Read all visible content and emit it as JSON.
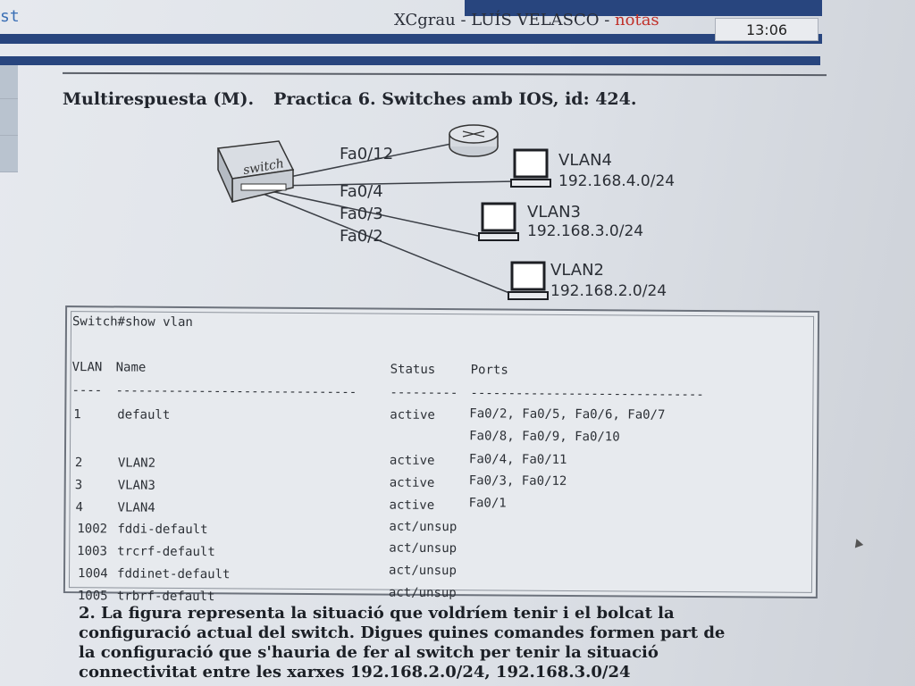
{
  "header": {
    "left_fragment": "st",
    "title_main": "XCgrau - LUÍS VELASCO - ",
    "title_suffix": "notas",
    "clock": "13:06"
  },
  "question": {
    "title_part1": "Multirespuesta (M).",
    "title_part2": "Practica 6. Switches amb IOS, id: 424.",
    "body_lines": [
      "2. La figura representa la situació que voldríem tenir i el bolcat la",
      "configuració actual del switch. Digues quines comandes formen part de",
      "la configuració que s'hauria de fer al switch per tenir la situació",
      "connectivitat entre les xarxes 192.168.2.0/24, 192.168.3.0/24"
    ]
  },
  "diagram": {
    "switch_label": "switch",
    "links": [
      {
        "port": "Fa0/12",
        "target": "router"
      },
      {
        "port": "Fa0/4",
        "target": "VLAN4"
      },
      {
        "port": "Fa0/3",
        "target": "VLAN3"
      },
      {
        "port": "Fa0/2",
        "target": "VLAN2"
      }
    ],
    "hosts": [
      {
        "vlan": "VLAN4",
        "network": "192.168.4.0/24"
      },
      {
        "vlan": "VLAN3",
        "network": "192.168.3.0/24"
      },
      {
        "vlan": "VLAN2",
        "network": "192.168.2.0/24"
      }
    ]
  },
  "terminal": {
    "command": "Switch#show vlan",
    "headers": {
      "vlan": "VLAN",
      "name": "Name",
      "status": "Status",
      "ports": "Ports"
    },
    "separator": {
      "vlan": "----",
      "name": "--------------------------------",
      "status": "---------",
      "ports": "-------------------------------"
    },
    "rows": [
      {
        "vlan": "1",
        "name": "default",
        "status": "active",
        "ports": [
          "Fa0/2, Fa0/5, Fa0/6, Fa0/7",
          "Fa0/8, Fa0/9, Fa0/10"
        ]
      },
      {
        "vlan": "2",
        "name": "VLAN2",
        "status": "active",
        "ports": [
          "Fa0/4, Fa0/11"
        ]
      },
      {
        "vlan": "3",
        "name": "VLAN3",
        "status": "active",
        "ports": [
          "Fa0/3, Fa0/12"
        ]
      },
      {
        "vlan": "4",
        "name": "VLAN4",
        "status": "active",
        "ports": [
          "Fa0/1"
        ]
      },
      {
        "vlan": "1002",
        "name": "fddi-default",
        "status": "act/unsup",
        "ports": []
      },
      {
        "vlan": "1003",
        "name": "trcrf-default",
        "status": "act/unsup",
        "ports": []
      },
      {
        "vlan": "1004",
        "name": "fddinet-default",
        "status": "act/unsup",
        "ports": []
      },
      {
        "vlan": "1005",
        "name": "trbrf-default",
        "status": "act/unsup",
        "ports": []
      }
    ]
  }
}
